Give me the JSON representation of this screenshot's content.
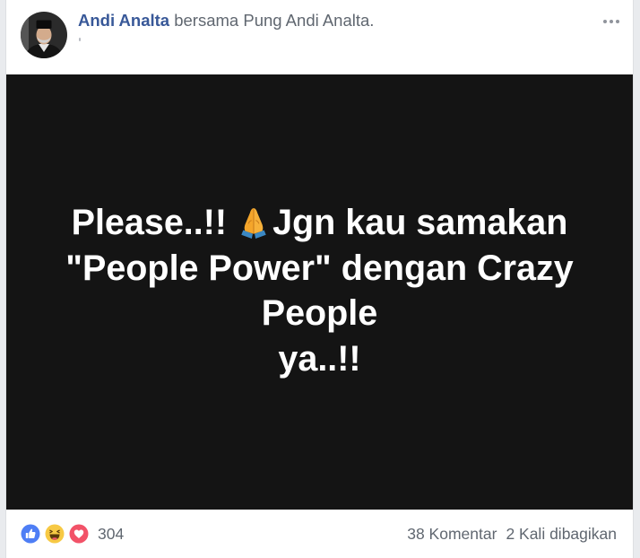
{
  "post": {
    "author_name": "Andi Analta",
    "with_prefix": "bersama",
    "with_name": "Pung Andi Analta.",
    "audience_icon": "audience-icon",
    "menu_icon": "more-options-icon"
  },
  "image": {
    "line1_before": "Please..!!",
    "line1_emoji": "praying-hands-icon",
    "line1_after": "Jgn kau samakan",
    "line2": "\"People Power\" dengan Crazy",
    "line3": "People",
    "line4": "ya..!!"
  },
  "footer": {
    "reaction_icons": [
      "like-reaction-icon",
      "haha-reaction-icon",
      "love-reaction-icon"
    ],
    "reaction_count": "304",
    "comments": "38 Komentar",
    "shares": "2 Kali dibagikan"
  },
  "colors": {
    "page_bg": "#e9ebee",
    "card_border": "#dddfe2",
    "link": "#385898",
    "meta": "#606770",
    "image_bg": "#141414",
    "image_text": "#ffffff",
    "like": "#4e7ef5",
    "haha": "#f7c944",
    "love": "#f25268"
  }
}
